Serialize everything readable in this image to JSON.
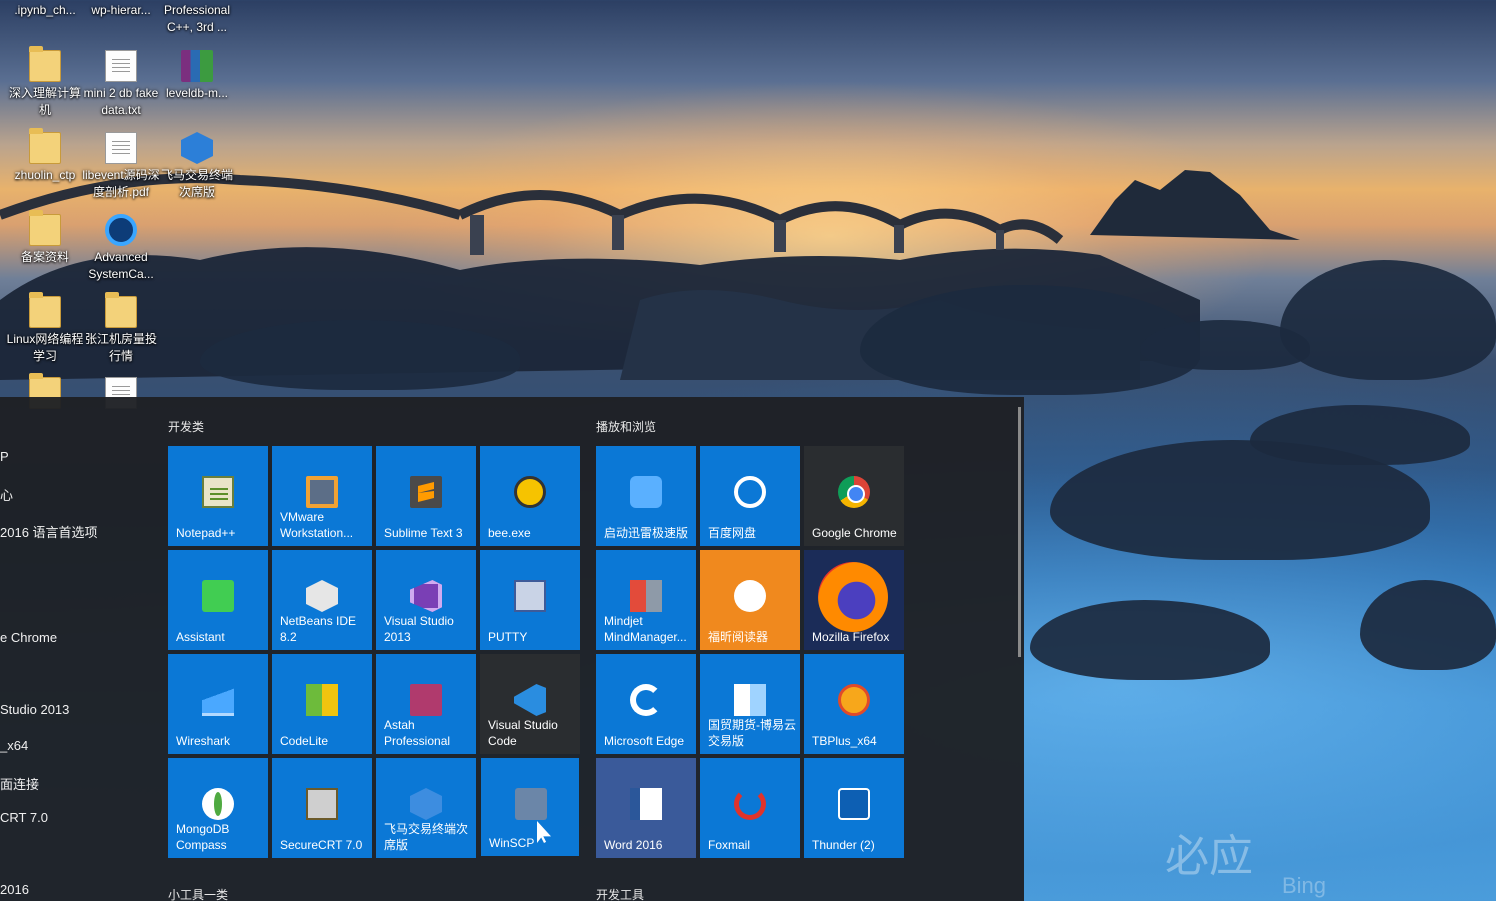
{
  "desktop": {
    "icons": [
      {
        "label": ".ipynb_ch...",
        "type": "file"
      },
      {
        "label": "wp-hierar...",
        "type": "file"
      },
      {
        "label": "Professional C++, 3rd ...",
        "type": "file"
      },
      {
        "label": "深入理解计算机",
        "type": "folder"
      },
      {
        "label": "mini 2 db fake data.txt",
        "type": "text"
      },
      {
        "label": "leveldb-m...",
        "type": "archive"
      },
      {
        "label": "zhuolin_ctp",
        "type": "folder"
      },
      {
        "label": "libevent源码深度剖析.pdf",
        "type": "pdf"
      },
      {
        "label": "飞马交易终端次席版",
        "type": "app"
      },
      {
        "label": "备案资料",
        "type": "folder"
      },
      {
        "label": "Advanced SystemCa...",
        "type": "app"
      },
      {
        "label": "Linux网络编程学习",
        "type": "folder"
      },
      {
        "label": "张江机房量投行情",
        "type": "folder"
      }
    ],
    "watermark": {
      "brand": "必应",
      "sub": "Bing"
    }
  },
  "start_menu": {
    "app_list": [
      "P",
      "心",
      "2016 语言首选项",
      "e Chrome",
      "Studio 2013",
      "_x64",
      "面连接",
      "CRT 7.0",
      "2016"
    ],
    "groups": [
      {
        "title": "开发类"
      },
      {
        "title": "播放和浏览"
      },
      {
        "title": "小工具一类"
      },
      {
        "title": "开发工具"
      }
    ],
    "tiles_dev": [
      {
        "label": "Notepad++",
        "icon": "notepad-icon"
      },
      {
        "label": "VMware Workstation...",
        "icon": "vmware-icon"
      },
      {
        "label": "Sublime Text 3",
        "icon": "sublime-icon"
      },
      {
        "label": "bee.exe",
        "icon": "bee-icon"
      },
      {
        "label": "Assistant",
        "icon": "qt-icon"
      },
      {
        "label": "NetBeans IDE 8.2",
        "icon": "netbeans-icon"
      },
      {
        "label": "Visual Studio 2013",
        "icon": "visual-studio-icon"
      },
      {
        "label": "PUTTY",
        "icon": "putty-icon"
      },
      {
        "label": "Wireshark",
        "icon": "wireshark-icon"
      },
      {
        "label": "CodeLite",
        "icon": "codelite-icon"
      },
      {
        "label": "Astah Professional",
        "icon": "astah-icon"
      },
      {
        "label": "Visual Studio Code",
        "icon": "vscode-icon"
      },
      {
        "label": "MongoDB Compass",
        "icon": "mongodb-icon"
      },
      {
        "label": "SecureCRT 7.0",
        "icon": "securecrt-icon"
      },
      {
        "label": "飞马交易终端次席版",
        "icon": "feima-icon"
      },
      {
        "label": "WinSCP",
        "icon": "winscp-icon"
      }
    ],
    "tiles_media": [
      {
        "label": "启动迅雷极速版",
        "icon": "xunlei-icon"
      },
      {
        "label": "百度网盘",
        "icon": "baidu-pan-icon"
      },
      {
        "label": "Google Chrome",
        "icon": "chrome-icon"
      },
      {
        "label": "Mindjet MindManager...",
        "icon": "mindjet-icon"
      },
      {
        "label": "福昕阅读器",
        "icon": "foxit-icon"
      },
      {
        "label": "Mozilla Firefox",
        "icon": "firefox-icon"
      },
      {
        "label": "Microsoft Edge",
        "icon": "edge-icon"
      },
      {
        "label": "国贸期货-博易云交易版",
        "icon": "boyi-icon"
      },
      {
        "label": "TBPlus_x64",
        "icon": "tbplus-icon"
      },
      {
        "label": "Word 2016",
        "icon": "word-icon"
      },
      {
        "label": "Foxmail",
        "icon": "foxmail-icon"
      },
      {
        "label": "Thunder (2)",
        "icon": "thunder-icon"
      }
    ]
  }
}
